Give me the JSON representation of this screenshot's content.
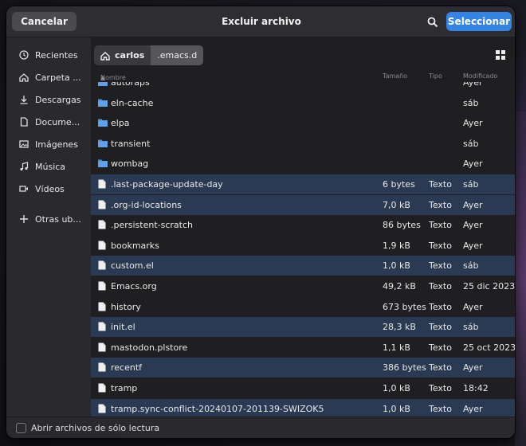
{
  "header": {
    "cancel_label": "Cancelar",
    "title": "Excluir archivo",
    "select_label": "Seleccionar"
  },
  "sidebar": {
    "items": [
      {
        "icon": "clock-icon",
        "label": "Recientes"
      },
      {
        "icon": "home-icon",
        "label": "Carpeta ..."
      },
      {
        "icon": "download-icon",
        "label": "Descargas"
      },
      {
        "icon": "document-icon",
        "label": "Docume..."
      },
      {
        "icon": "image-icon",
        "label": "Imágenes"
      },
      {
        "icon": "music-icon",
        "label": "Música"
      },
      {
        "icon": "video-icon",
        "label": "Vídeos"
      },
      {
        "icon": "plus-icon",
        "label": "Otras ub..."
      }
    ]
  },
  "pathbar": {
    "home_label": "carlos",
    "current_label": ".emacs.d"
  },
  "columns": {
    "name": "Nombre",
    "size": "Tamaño",
    "type": "Tipo",
    "modified": "Modificado"
  },
  "files": [
    {
      "name": "autoraps",
      "size": "",
      "type": "",
      "modified": "Ayer",
      "kind": "folder",
      "selected": false
    },
    {
      "name": "eln-cache",
      "size": "",
      "type": "",
      "modified": "sáb",
      "kind": "folder",
      "selected": false
    },
    {
      "name": "elpa",
      "size": "",
      "type": "",
      "modified": "Ayer",
      "kind": "folder",
      "selected": false
    },
    {
      "name": "transient",
      "size": "",
      "type": "",
      "modified": "sáb",
      "kind": "folder",
      "selected": false
    },
    {
      "name": "wombag",
      "size": "",
      "type": "",
      "modified": "Ayer",
      "kind": "folder",
      "selected": false
    },
    {
      "name": ".last-package-update-day",
      "size": "6 bytes",
      "type": "Texto",
      "modified": "sáb",
      "kind": "file",
      "selected": true
    },
    {
      "name": ".org-id-locations",
      "size": "7,0 kB",
      "type": "Texto",
      "modified": "Ayer",
      "kind": "file",
      "selected": true
    },
    {
      "name": ".persistent-scratch",
      "size": "86 bytes",
      "type": "Texto",
      "modified": "Ayer",
      "kind": "file",
      "selected": false
    },
    {
      "name": "bookmarks",
      "size": "1,9 kB",
      "type": "Texto",
      "modified": "Ayer",
      "kind": "file",
      "selected": false
    },
    {
      "name": "custom.el",
      "size": "1,0 kB",
      "type": "Texto",
      "modified": "sáb",
      "kind": "file",
      "selected": true
    },
    {
      "name": "Emacs.org",
      "size": "49,2 kB",
      "type": "Texto",
      "modified": "25 dic 2023",
      "kind": "file",
      "selected": false
    },
    {
      "name": "history",
      "size": "673 bytes",
      "type": "Texto",
      "modified": "Ayer",
      "kind": "file",
      "selected": false
    },
    {
      "name": "init.el",
      "size": "28,3 kB",
      "type": "Texto",
      "modified": "sáb",
      "kind": "file",
      "selected": true
    },
    {
      "name": "mastodon.plstore",
      "size": "1,1 kB",
      "type": "Texto",
      "modified": "25 oct 2023",
      "kind": "file",
      "selected": false
    },
    {
      "name": "recentf",
      "size": "386 bytes",
      "type": "Texto",
      "modified": "Ayer",
      "kind": "file",
      "selected": true
    },
    {
      "name": "tramp",
      "size": "1,0 kB",
      "type": "Texto",
      "modified": "18:42",
      "kind": "file",
      "selected": false
    },
    {
      "name": "tramp.sync-conflict-20240107-201139-SWIZOK5",
      "size": "1,0 kB",
      "type": "Texto",
      "modified": "Ayer",
      "kind": "file",
      "selected": true
    }
  ],
  "footer": {
    "readonly_label": "Abrir archivos de sólo lectura"
  },
  "colors": {
    "accent": "#3584e4",
    "selection": "#2a3a52",
    "folder": "#4a90d9"
  }
}
